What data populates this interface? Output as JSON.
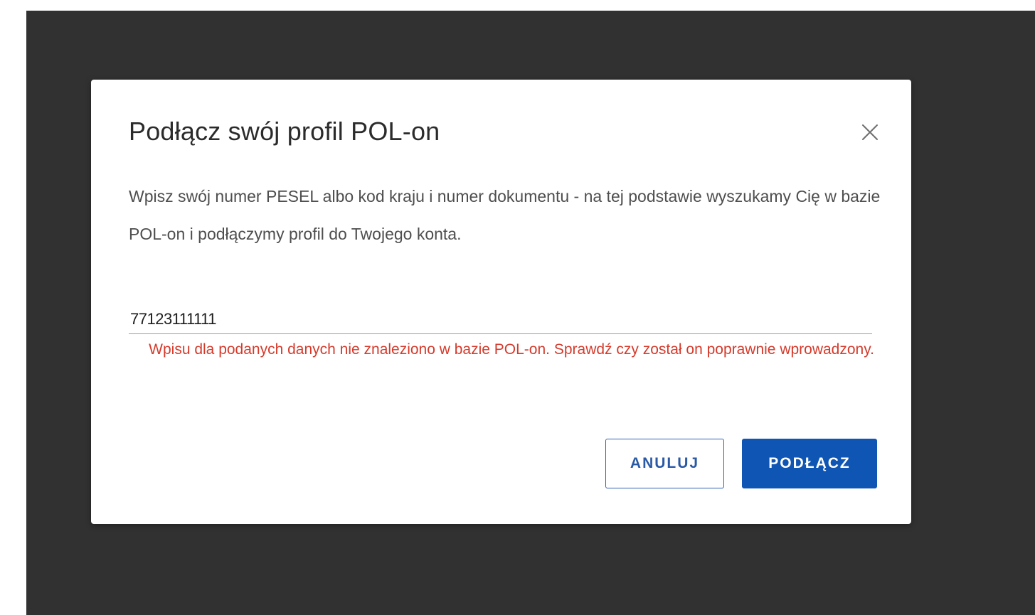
{
  "modal": {
    "title": "Podłącz swój profil POL-on",
    "description": "Wpisz swój numer PESEL albo kod kraju i numer dokumentu - na tej podstawie wyszukamy Cię w bazie POL-on i podłączymy profil do Twojego konta.",
    "close_icon": "close-icon"
  },
  "form": {
    "pesel_value": "77123111111",
    "error": "Wpisu dla podanych danych nie znaleziono w bazie POL-on. Sprawdź czy został on poprawnie wprowadzony."
  },
  "actions": {
    "cancel_label": "ANULUJ",
    "submit_label": "PODŁĄCZ"
  },
  "colors": {
    "overlay": "#313131",
    "primary": "#0f55b3",
    "error": "#d53a2b",
    "title": "#2b2b2b"
  }
}
